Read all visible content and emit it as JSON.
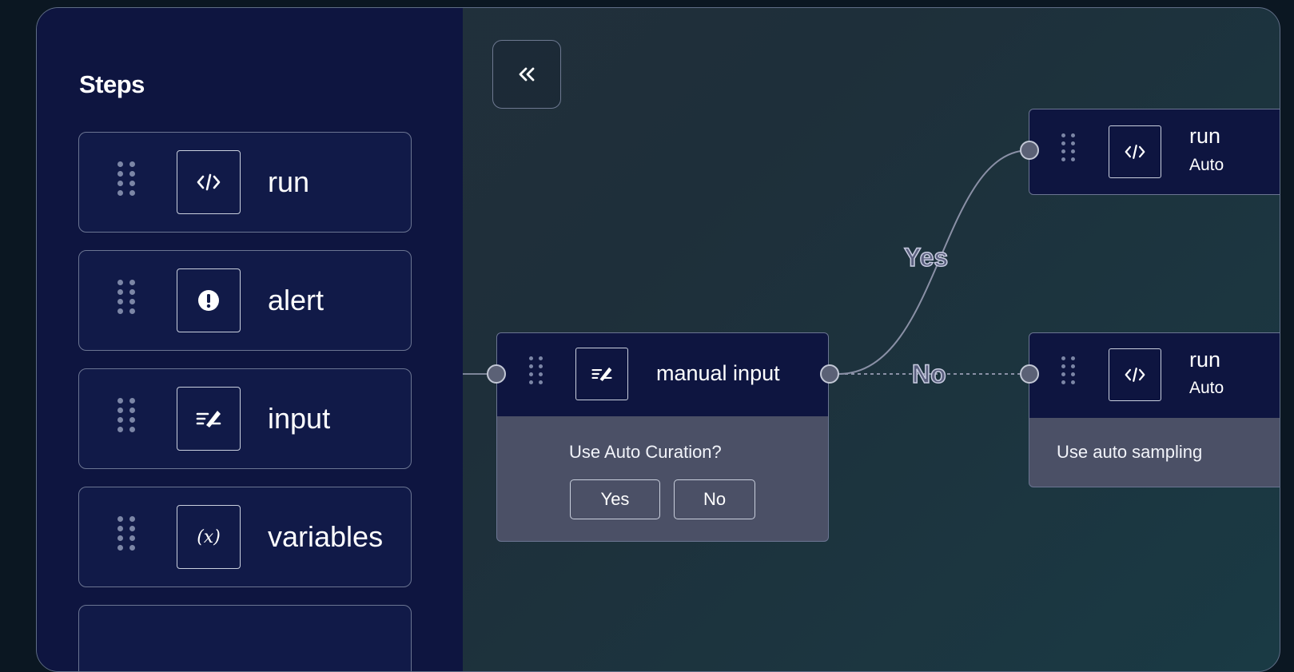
{
  "sidebar": {
    "title": "Steps",
    "items": [
      {
        "label": "run",
        "icon": "code-icon"
      },
      {
        "label": "alert",
        "icon": "alert-icon"
      },
      {
        "label": "input",
        "icon": "input-icon"
      },
      {
        "label": "variables",
        "icon": "variables-icon"
      }
    ]
  },
  "canvas": {
    "collapse_symbol": "«",
    "manual_node": {
      "title": "manual input",
      "question": "Use Auto Curation?",
      "yes_label": "Yes",
      "no_label": "No"
    },
    "run_node_top": {
      "title": "run",
      "subtitle": "Auto"
    },
    "run_node_bottom": {
      "title": "run",
      "subtitle": "Auto",
      "body": "Use auto sampling"
    },
    "edges": {
      "yes_label": "Yes",
      "no_label": "No"
    }
  },
  "colors": {
    "sidebar_bg": "#0e1540",
    "node_header_bg": "#0e1540",
    "node_body_bg": "#4b5066",
    "canvas_bg": "#1e2f3a"
  }
}
